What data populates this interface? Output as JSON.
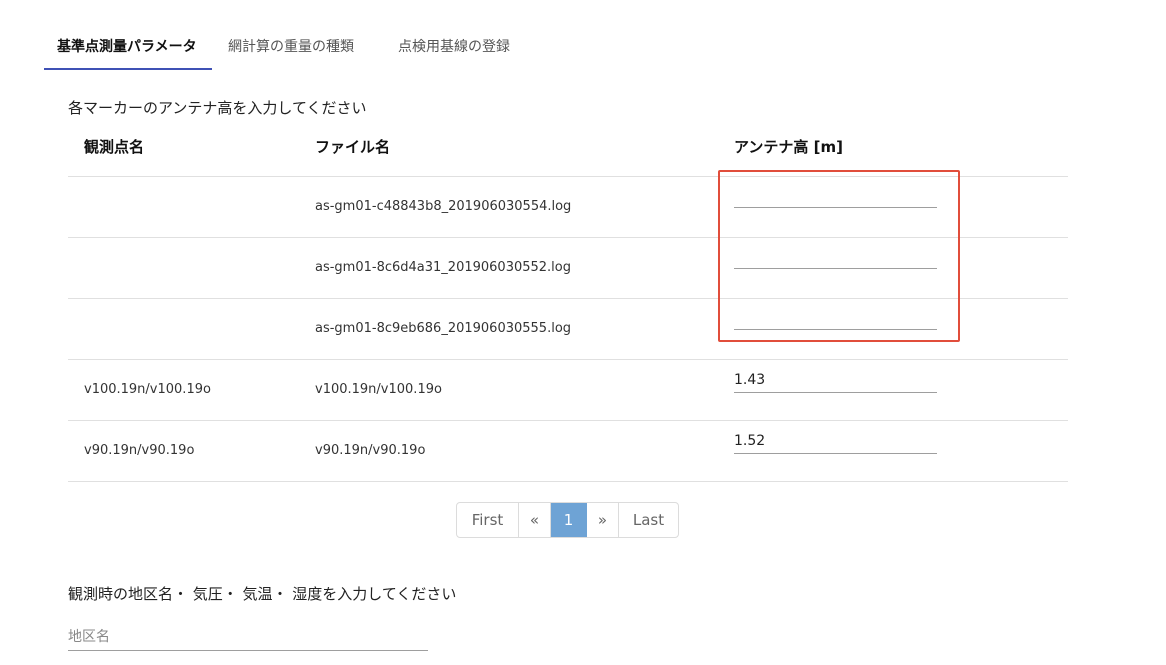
{
  "tabs": [
    {
      "label": "基準点測量パラメータ",
      "active": true
    },
    {
      "label": "網計算の重量の種類",
      "active": false
    },
    {
      "label": "点検用基線の登録",
      "active": false
    }
  ],
  "antenna_section": {
    "title": "各マーカーのアンテナ高を入力してください",
    "columns": [
      "観測点名",
      "ファイル名",
      "アンテナ高 [m]"
    ],
    "rows": [
      {
        "station": "",
        "file": "as-gm01-c48843b8_201906030554.log",
        "height": ""
      },
      {
        "station": "",
        "file": "as-gm01-8c6d4a31_201906030552.log",
        "height": ""
      },
      {
        "station": "",
        "file": "as-gm01-8c9eb686_201906030555.log",
        "height": ""
      },
      {
        "station": "v100.19n/v100.19o",
        "file": "v100.19n/v100.19o",
        "height": "1.43"
      },
      {
        "station": "v90.19n/v90.19o",
        "file": "v90.19n/v90.19o",
        "height": "1.52"
      }
    ]
  },
  "pagination": {
    "first": "First",
    "prev": "«",
    "current": "1",
    "next": "»",
    "last": "Last"
  },
  "weather_section": {
    "title": "観測時の地区名・ 気圧・ 気温・ 湿度を入力してください",
    "district_placeholder": "地区名"
  },
  "colors": {
    "tab_indicator": "#3f51b5",
    "highlight_border": "#e14d3b",
    "pagination_active": "#6ea3d5"
  }
}
